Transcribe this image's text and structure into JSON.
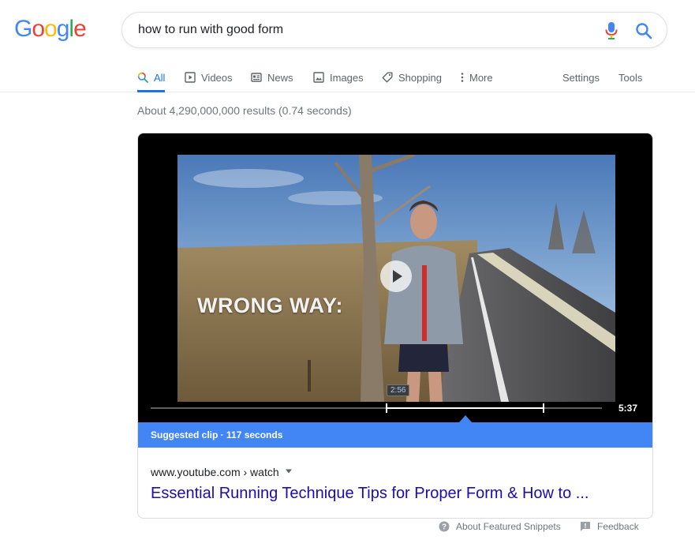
{
  "brand": {
    "logo_letters": [
      {
        "char": "G",
        "color": "#4285F4"
      },
      {
        "char": "o",
        "color": "#EA4335"
      },
      {
        "char": "o",
        "color": "#FBBC05"
      },
      {
        "char": "g",
        "color": "#4285F4"
      },
      {
        "char": "l",
        "color": "#34A853"
      },
      {
        "char": "e",
        "color": "#EA4335"
      }
    ]
  },
  "search": {
    "query": "how to run with good form"
  },
  "icons": {
    "mic": "microphone-icon",
    "search": "magnifier-icon"
  },
  "tabs": {
    "all": "All",
    "videos": "Videos",
    "news": "News",
    "images": "Images",
    "shopping": "Shopping",
    "more": "More",
    "settings": "Settings",
    "tools": "Tools"
  },
  "results": {
    "stats": "About 4,290,000,000 results (0.74 seconds)"
  },
  "featured_video": {
    "overlay_caption": "WRONG WAY:",
    "clip_start": "2:56",
    "duration": "5:37",
    "clip_start_fraction": 0.523,
    "clip_end_fraction": 0.87,
    "suggested_clip": "Suggested clip · 117 seconds",
    "source": "www.youtube.com › watch",
    "title": "Essential Running Technique Tips for Proper Form & How to ..."
  },
  "footer": {
    "about": "About Featured Snippets",
    "feedback": "Feedback"
  },
  "colors": {
    "accent": "#1a73e8",
    "link": "#1a0dab",
    "clip_bar": "#4285f4"
  }
}
